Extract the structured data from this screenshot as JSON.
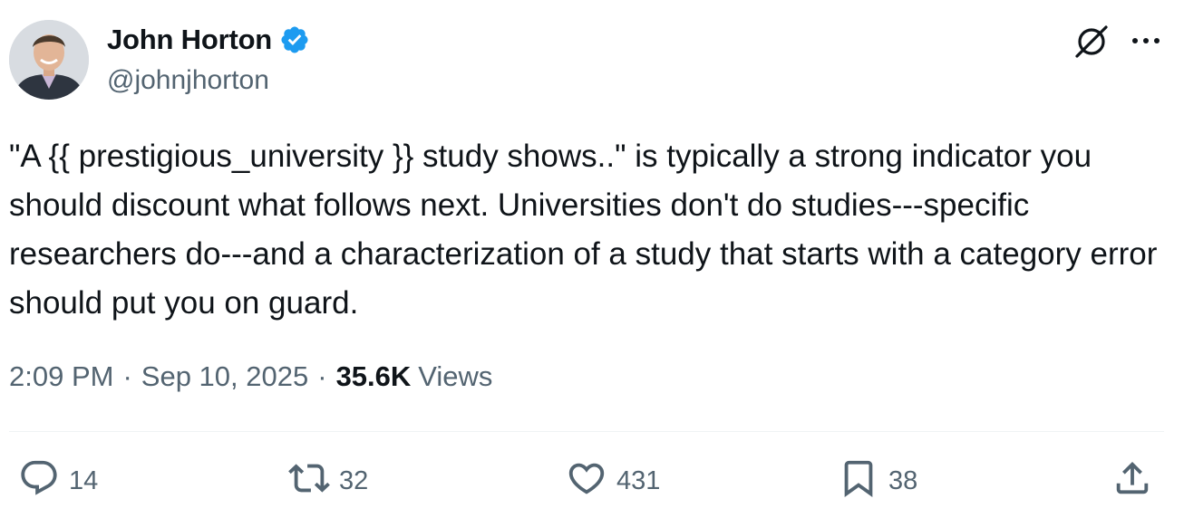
{
  "author": {
    "display_name": "John Horton",
    "handle": "@johnjhorton",
    "verified": true,
    "verified_color": "#1d9bf0"
  },
  "header_icons": [
    "grok-icon",
    "more-icon"
  ],
  "tweet": {
    "text": "\"A {{ prestigious_university }} study shows..\" is typically a strong indicator you should discount what follows next. Universities don't do studies---specific researchers do---and a characterization of a study that starts with a category error should put you on guard.",
    "time": "2:09 PM",
    "date": "Sep 10, 2025",
    "views_count": "35.6K",
    "views_label": "Views",
    "separator": "·"
  },
  "actions": {
    "replies": "14",
    "reposts": "32",
    "likes": "431",
    "bookmarks": "38"
  },
  "colors": {
    "text": "#0f1419",
    "secondary": "#536471",
    "divider": "#eff3f4"
  }
}
